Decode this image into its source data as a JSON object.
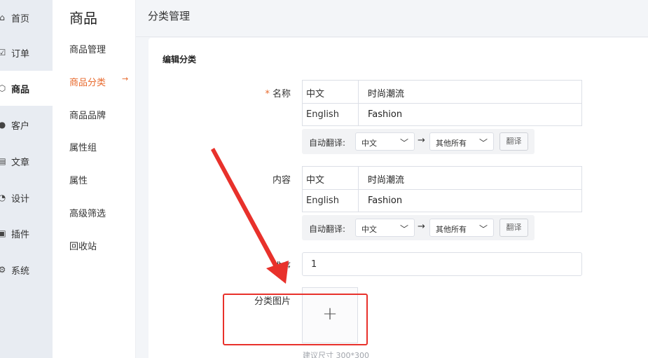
{
  "nav_primary": [
    {
      "label": "首页",
      "icon": "home-icon"
    },
    {
      "label": "订单",
      "icon": "order-icon"
    },
    {
      "label": "商品",
      "icon": "cube-icon"
    },
    {
      "label": "客户",
      "icon": "user-icon"
    },
    {
      "label": "文章",
      "icon": "article-icon"
    },
    {
      "label": "设计",
      "icon": "palette-icon"
    },
    {
      "label": "插件",
      "icon": "plugin-icon"
    },
    {
      "label": "系统",
      "icon": "gear-icon"
    }
  ],
  "nav_secondary": {
    "title": "商品",
    "items": [
      "商品管理",
      "商品分类",
      "商品品牌",
      "属性组",
      "属性",
      "高级筛选",
      "回收站"
    ],
    "active_arrow": "→"
  },
  "page": {
    "title": "分类管理",
    "card_title": "编辑分类"
  },
  "form": {
    "name": {
      "required_mark": "*",
      "label": "名称",
      "rows": [
        {
          "lang": "中文",
          "value": "时尚潮流"
        },
        {
          "lang": "English",
          "value": "Fashion"
        }
      ],
      "translate": {
        "label": "自动翻译:",
        "from": "中文",
        "arrow": "→",
        "to": "其他所有",
        "button": "翻译"
      }
    },
    "content": {
      "label": "内容",
      "rows": [
        {
          "lang": "中文",
          "value": "时尚潮流"
        },
        {
          "lang": "English",
          "value": "Fashion"
        }
      ],
      "translate": {
        "label": "自动翻译:",
        "from": "中文",
        "arrow": "→",
        "to": "其他所有",
        "button": "翻译"
      }
    },
    "sort": {
      "label": "排序",
      "value": "1"
    },
    "image": {
      "label": "分类图片",
      "plus": "+",
      "hint": "建议尺寸 300*300"
    }
  },
  "colors": {
    "accent": "#e8692c",
    "annotation": "#e8312b"
  }
}
